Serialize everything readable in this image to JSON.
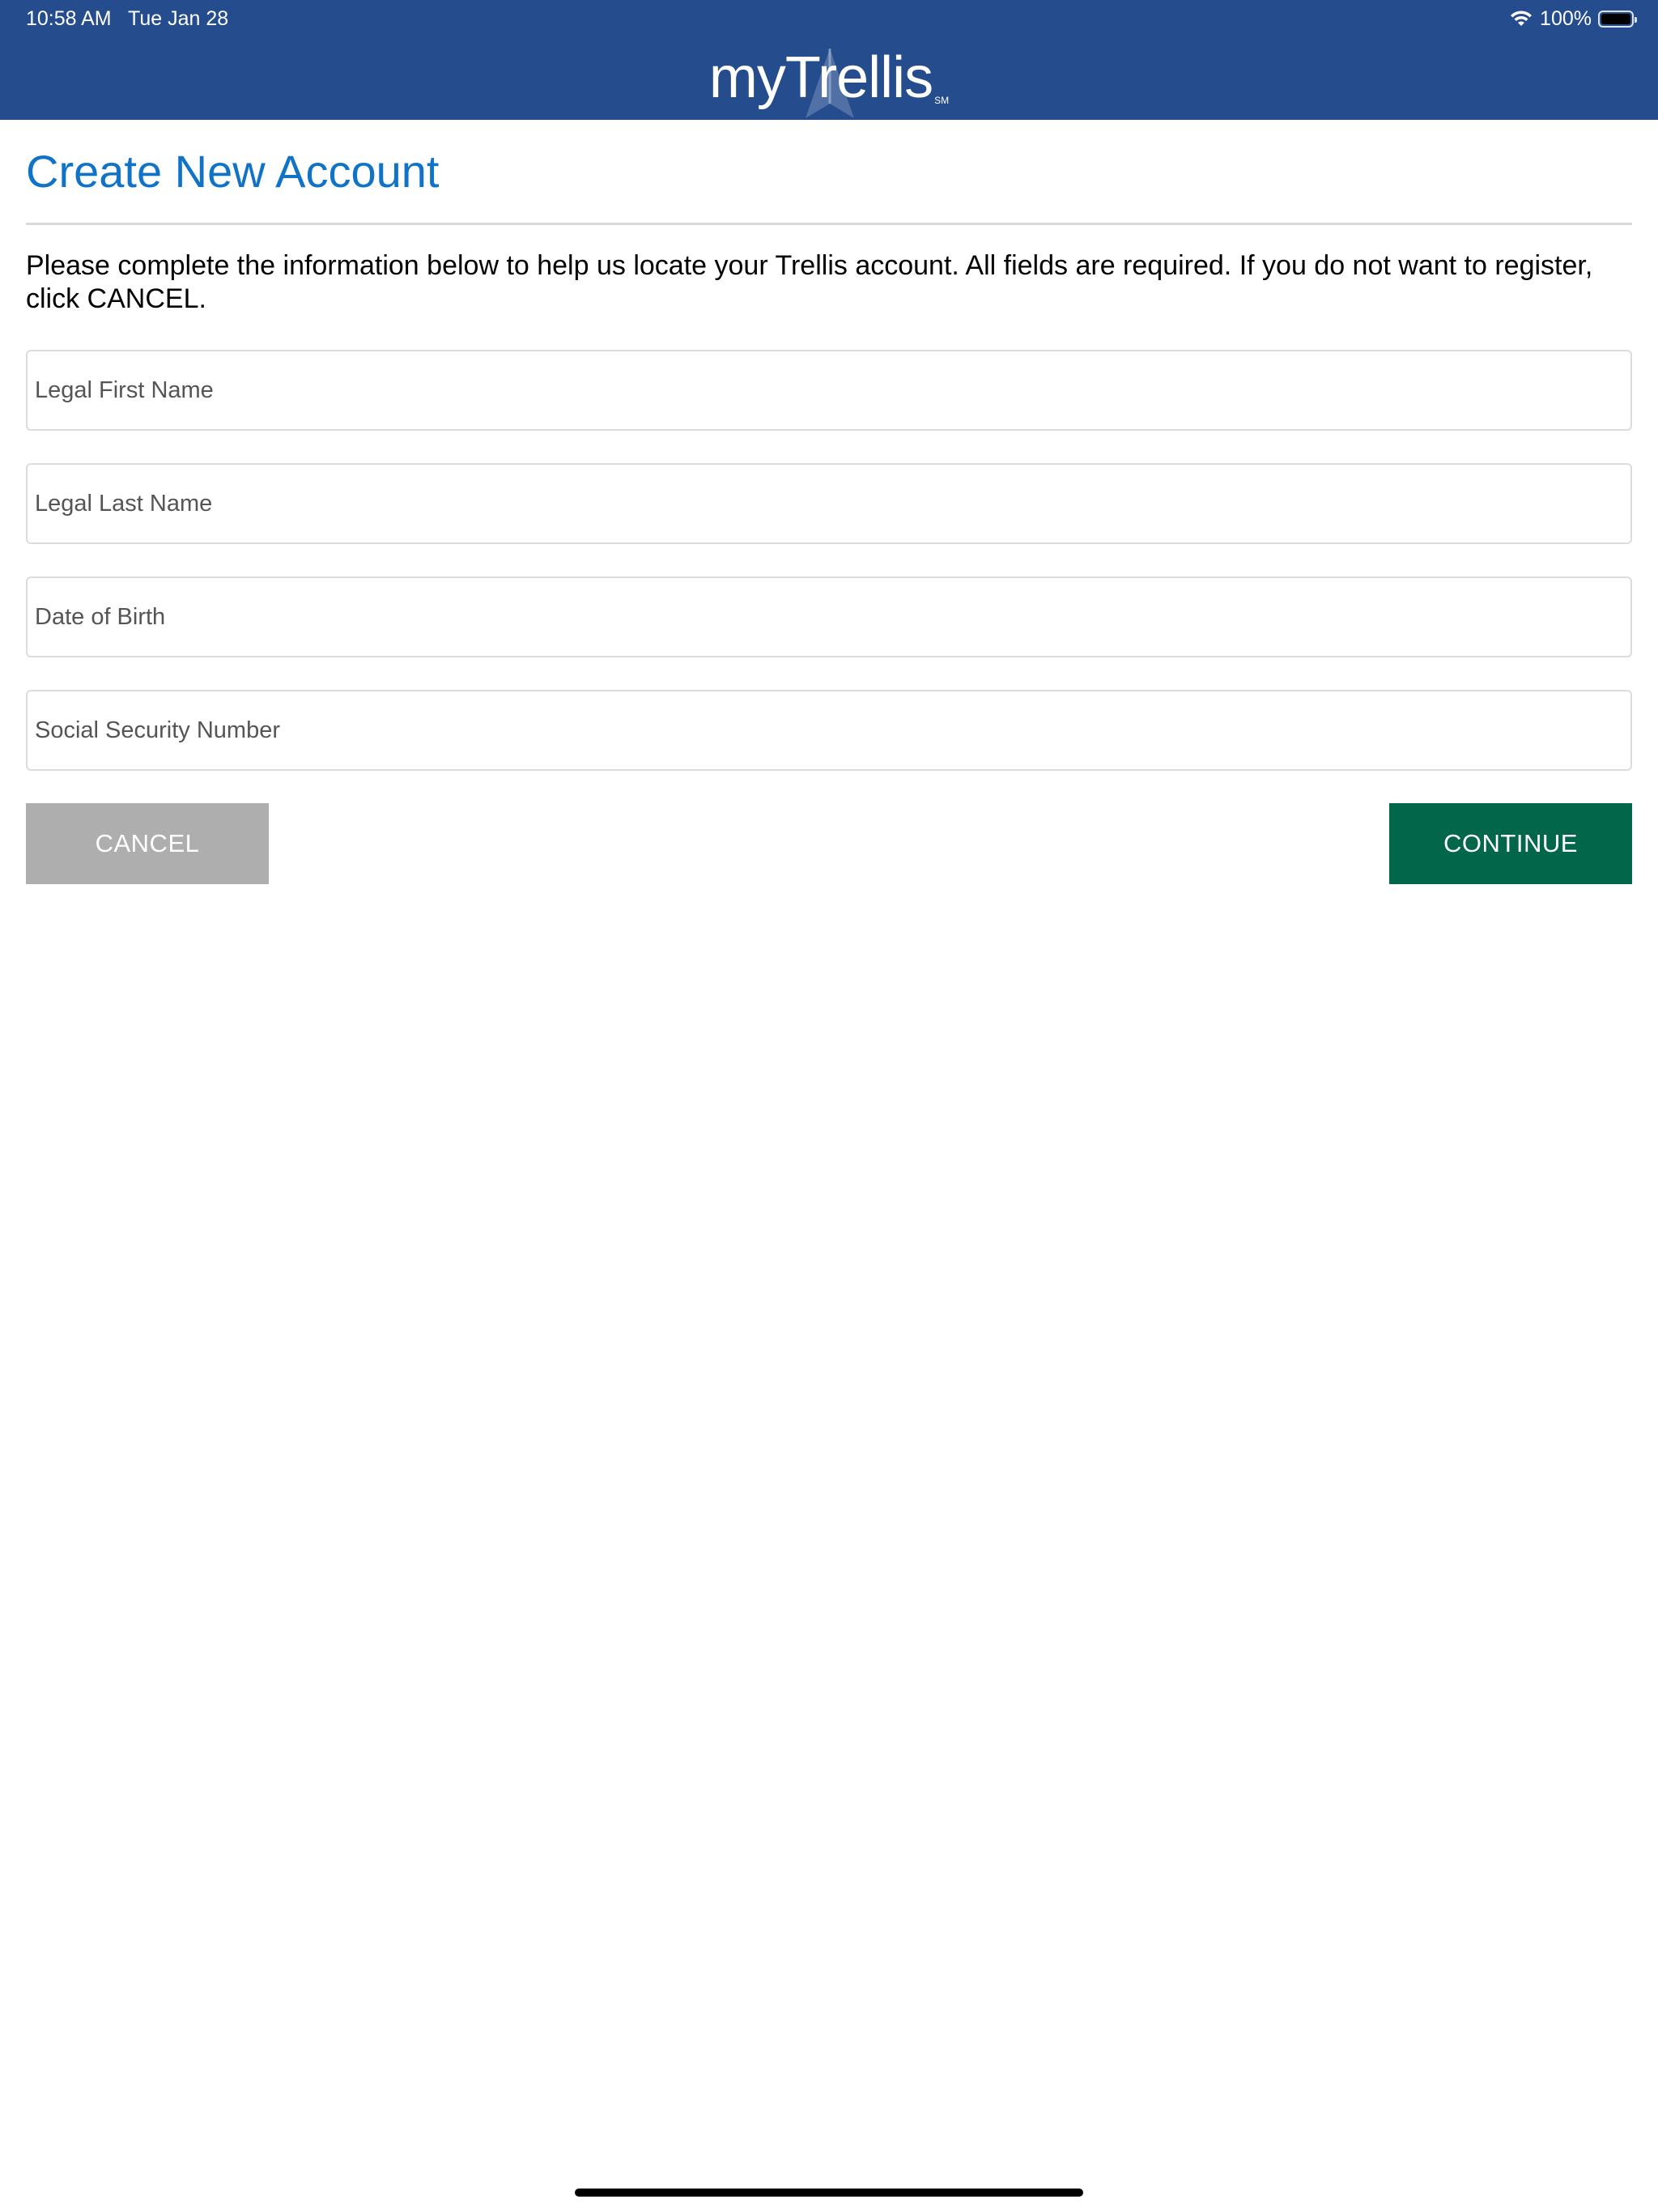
{
  "status_bar": {
    "time": "10:58 AM   Tue Jan 28",
    "battery": "100%"
  },
  "header": {
    "logo": "myTrellis",
    "logo_mark": "SM",
    "bg_color": "#254c8c"
  },
  "page": {
    "title": "Create New Account",
    "instructions": "Please complete the information below to help us locate your Trellis account.  All fields are required. If you do not want to register, click CANCEL."
  },
  "form": {
    "fields": [
      {
        "placeholder": "Legal First Name",
        "value": ""
      },
      {
        "placeholder": "Legal Last Name",
        "value": ""
      },
      {
        "placeholder": "Date of Birth",
        "value": ""
      },
      {
        "placeholder": "Social Security Number",
        "value": ""
      }
    ]
  },
  "buttons": {
    "cancel_label": "CANCEL",
    "continue_label": "CONTINUE",
    "cancel_color": "#aeaeae",
    "continue_color": "#02674a"
  },
  "colors": {
    "title": "#1173c7"
  }
}
